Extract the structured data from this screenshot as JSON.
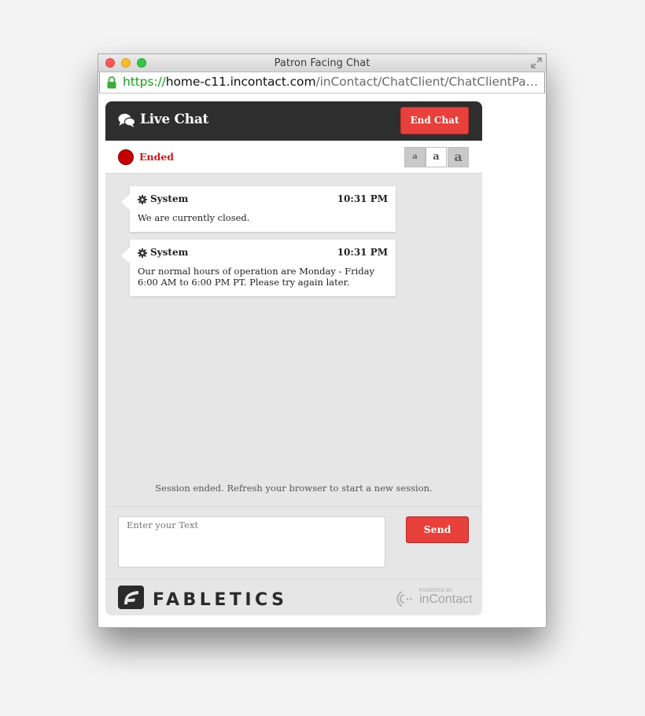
{
  "window": {
    "title": "Patron Facing Chat",
    "url_scheme": "https://",
    "url_host": "home-c11.incontact.com",
    "url_path": "/inContact/ChatClient/ChatClientPatron.as..."
  },
  "chat": {
    "header_title": "Live Chat",
    "end_chat_label": "End Chat",
    "status": "Ended",
    "font_sizes": [
      "a",
      "a",
      "a"
    ],
    "messages": [
      {
        "sender": "System",
        "time": "10:31 PM",
        "text": "We are currently closed."
      },
      {
        "sender": "System",
        "time": "10:31 PM",
        "text": "Our normal hours of operation are Monday - Friday 6:00 AM to 6:00 PM PT. Please try again later."
      }
    ],
    "session_note": "Session ended. Refresh your browser to start a new session.",
    "input_placeholder": "Enter your Text",
    "send_label": "Send"
  },
  "footer": {
    "brand": "FABLETICS",
    "powered_by": "POWERED BY",
    "powered_brand": "inContact"
  },
  "colors": {
    "accent_red": "#e8403b",
    "status_red": "#c20000",
    "header_dark": "#2e2e2e"
  }
}
